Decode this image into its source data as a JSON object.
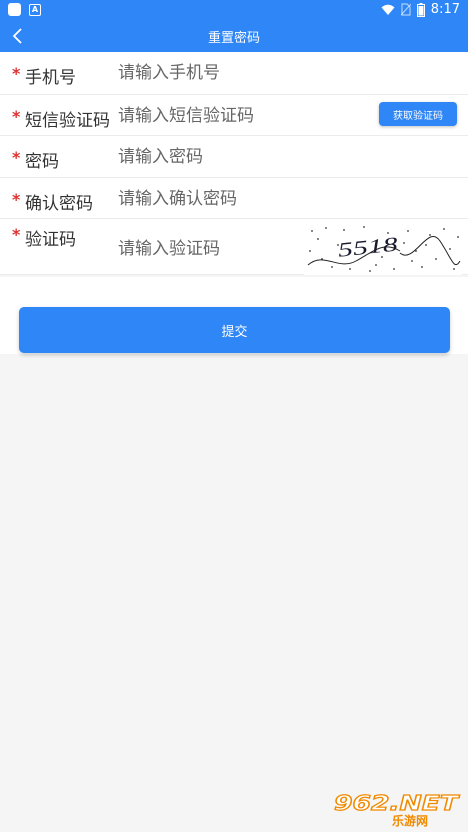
{
  "status_bar": {
    "time": "8:17",
    "icons": [
      "app-square-icon",
      "a-badge-icon",
      "wifi-icon",
      "no-sim-icon",
      "battery-icon"
    ]
  },
  "header": {
    "title": "重置密码",
    "back_icon": "chevron-left-icon"
  },
  "form": {
    "phone": {
      "label": "手机号",
      "placeholder": "请输入手机号",
      "required_mark": "*"
    },
    "sms_code": {
      "label": "短信验证码",
      "placeholder": "请输入短信验证码",
      "required_mark": "*",
      "button_label": "获取验证码"
    },
    "password": {
      "label": "密码",
      "placeholder": "请输入密码",
      "required_mark": "*"
    },
    "confirm_password": {
      "label": "确认密码",
      "placeholder": "请输入确认密码",
      "required_mark": "*"
    },
    "captcha": {
      "label": "验证码",
      "placeholder": "请输入验证码",
      "required_mark": "*",
      "image_text": "5518"
    }
  },
  "submit": {
    "label": "提交"
  },
  "watermark": {
    "text": "962.NET",
    "subtext": "乐游网"
  },
  "colors": {
    "primary": "#2f86f6",
    "required": "#dd3333",
    "background": "#f5f5f5"
  }
}
